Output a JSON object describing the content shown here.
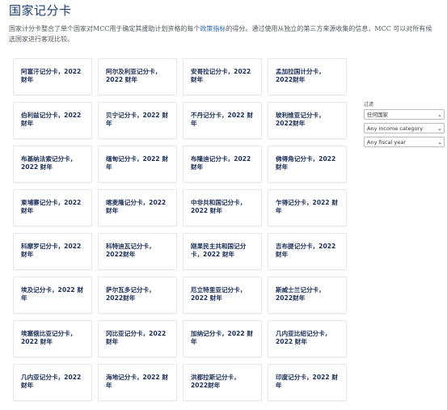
{
  "page": {
    "title": "国家记分卡",
    "intro_before": "国家计分卡整合了单个国家对MCC用于确定其援助计划资格的每个",
    "intro_link": "政策指标",
    "intro_after": "的得分。通过使用从独立的第三方来源收集的信息，MCC 可以对所有候选国家进行客观比较。"
  },
  "cards": [
    "阿富汗记分卡，2022财年",
    "阿尔及利亚记分卡，2022 财年",
    "安哥拉记分卡，2022财年",
    "孟加拉国计分卡，2022财年",
    "伯利兹记分卡，2022财年",
    "贝宁记分卡，2022 财年",
    "不丹记分卡，2022 财年",
    "玻利维亚记分卡，2022财年",
    "布基纳法索记分卡，2022 财年",
    "缅甸记分卡，2022 财年",
    "布隆迪记分卡，2022财年",
    "佛得角记分卡，2022财年",
    "柬埔寨记分卡，2022财年",
    "喀麦隆记分卡，2022财年",
    "中非共和国记分卡，2022 财年",
    "乍得记分卡，2022 财年",
    "科摩罗记分卡，2022财年",
    "科特迪瓦记分卡，2022财年",
    "刚果民主共和国记分卡，2022 财年",
    "吉布提记分卡，2022财年",
    "埃及记分卡，2022 财年",
    "萨尔瓦多记分卡，2022财年",
    "厄立特里亚记分卡，2022 财年",
    "斯威士兰记分卡，2022财年",
    "埃塞俄比亚记分卡，2022 财年",
    "冈比亚记分卡，2022财年",
    "加纳记分卡，2022 财年",
    "几内亚比绍记分卡，2022 财年",
    "几内亚记分卡，2022财年",
    "海地记分卡，2022 财年",
    "洪都拉斯记分卡，2022财年",
    "印度记分卡，2022 财年"
  ],
  "filters": {
    "label": "过滤",
    "country": "任何国家",
    "income": "Any income category",
    "fiscal_year": "Any fiscal year"
  }
}
